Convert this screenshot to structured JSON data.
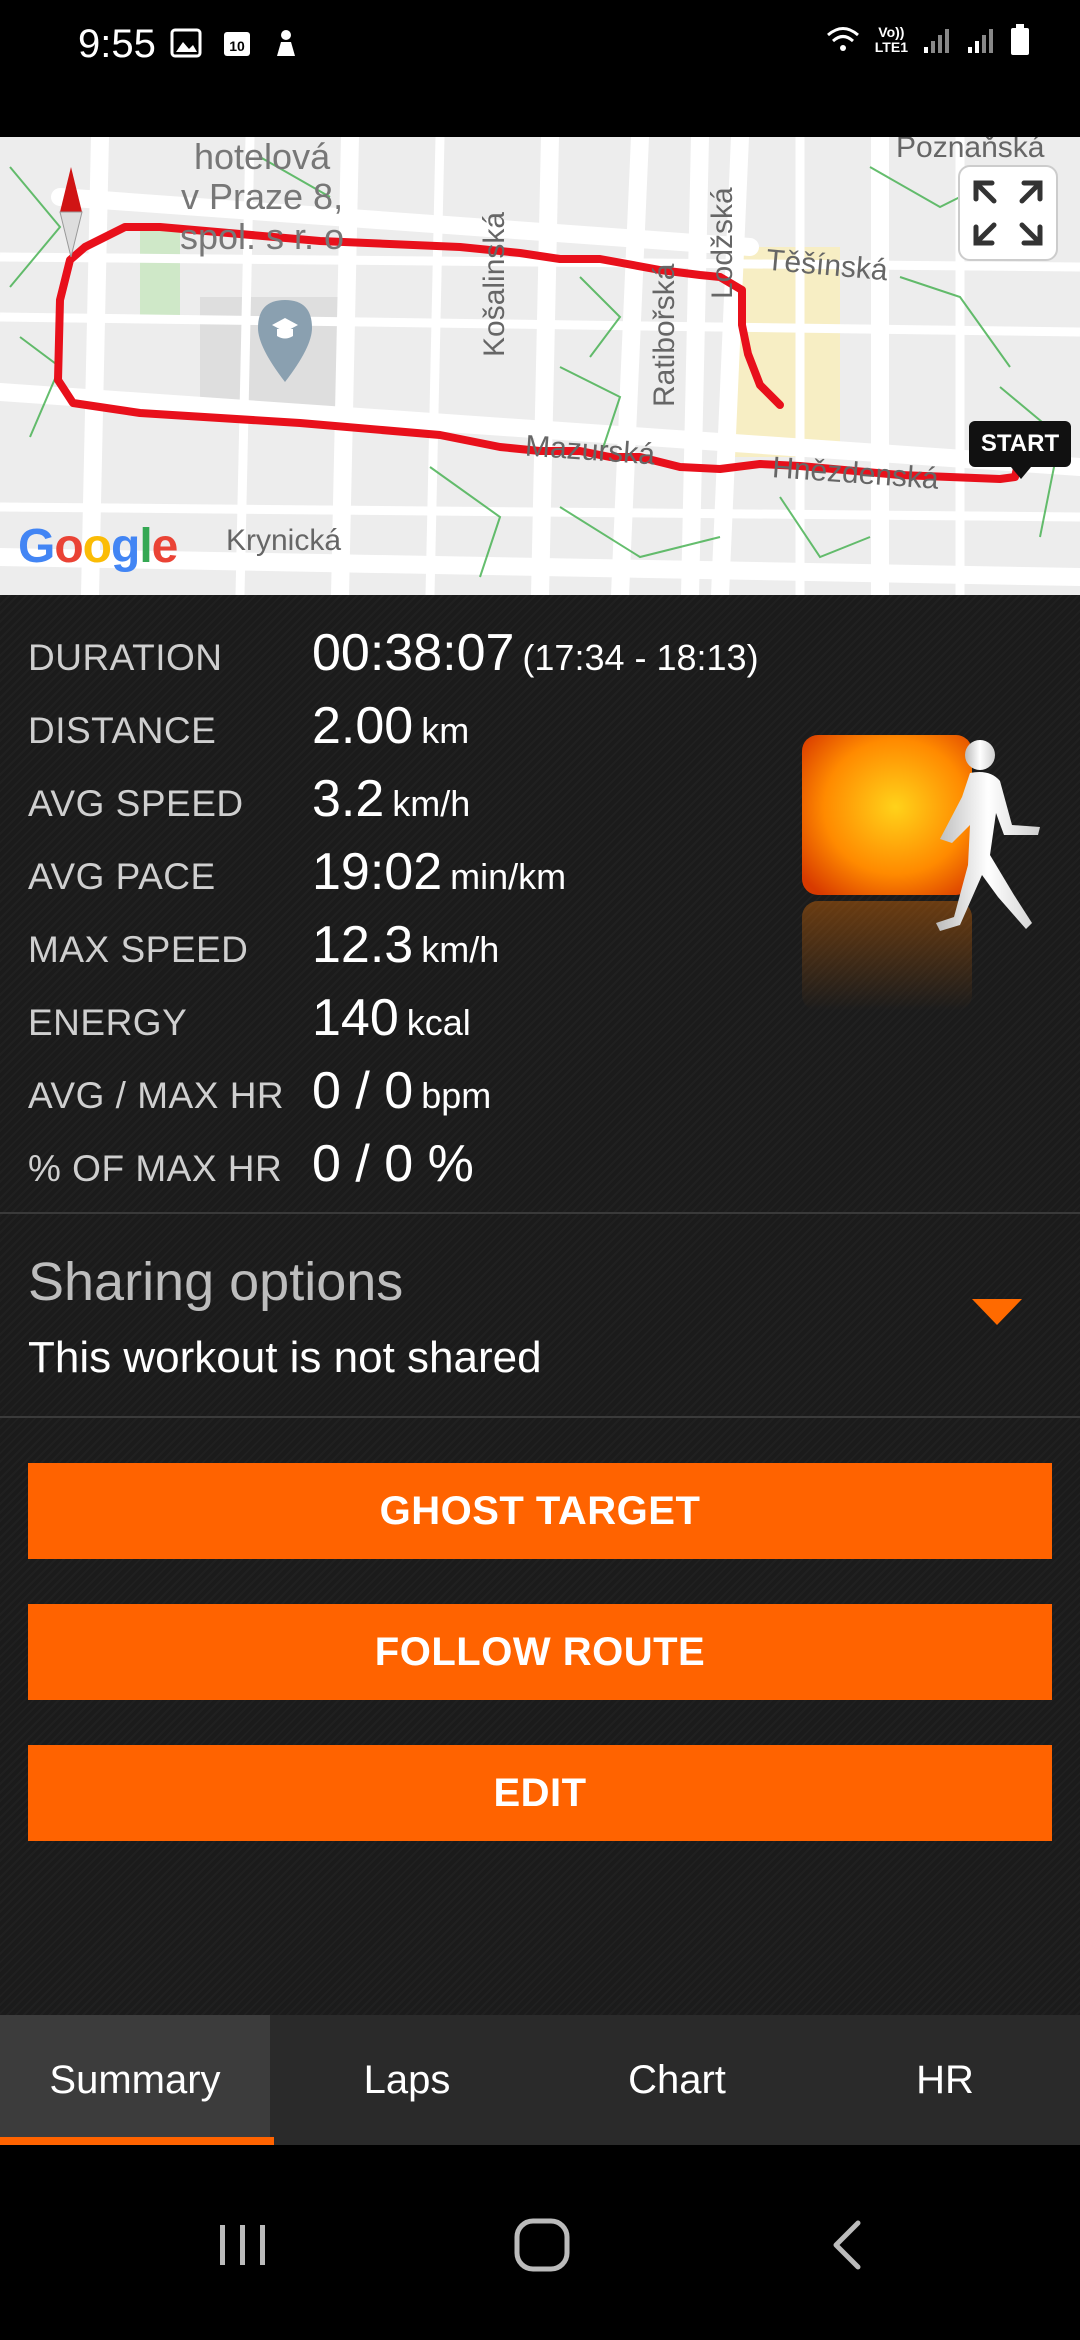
{
  "status_bar": {
    "time": "9:55",
    "left_icons": [
      "image-icon",
      "calendar-icon",
      "person-icon"
    ],
    "calendar_day": "10",
    "right_icons": [
      "wifi-icon",
      "lte-icon",
      "signal-icon",
      "signal-icon",
      "battery-icon"
    ],
    "lte_text_top": "Vo))",
    "lte_text_bottom": "LTE1"
  },
  "map": {
    "labels": {
      "poi_line1": "hotelová",
      "poi_line2": "v Praze 8,",
      "poi_line3": "spol. s r. o",
      "poznanska": "Poznaňská",
      "tesinska": "Těšínská",
      "kosalinska": "Košalinská",
      "ratiborska": "Ratibořská",
      "lodzska": "Lodžská",
      "mazurska": "Mazurská",
      "hnezdenska": "Hnězdenská",
      "krynicka": "Krynická"
    },
    "start_label": "START",
    "google": {
      "G": "G",
      "o1": "o",
      "o2": "o",
      "g": "g",
      "l": "l",
      "e": "e"
    },
    "route_color": "#e8101b"
  },
  "stats": [
    {
      "label": "DURATION",
      "value": "00:38:07",
      "unit": "(17:34 - 18:13)"
    },
    {
      "label": "DISTANCE",
      "value": "2.00",
      "unit": "km"
    },
    {
      "label": "AVG SPEED",
      "value": "3.2",
      "unit": "km/h"
    },
    {
      "label": "AVG PACE",
      "value": "19:02",
      "unit": "min/km"
    },
    {
      "label": "MAX SPEED",
      "value": "12.3",
      "unit": "km/h"
    },
    {
      "label": "ENERGY",
      "value": "140",
      "unit": "kcal"
    },
    {
      "label": "AVG / MAX HR",
      "value": "0 / 0",
      "unit": "bpm"
    },
    {
      "label": "% OF MAX HR",
      "value": "0 / 0 %",
      "unit": ""
    }
  ],
  "sharing": {
    "title": "Sharing options",
    "subtitle": "This workout is not shared"
  },
  "buttons": {
    "ghost_target": "GHOST TARGET",
    "follow_route": "FOLLOW ROUTE",
    "edit": "EDIT"
  },
  "tabs": [
    "Summary",
    "Laps",
    "Chart",
    "HR"
  ],
  "active_tab": "Summary",
  "colors": {
    "accent": "#ff6300",
    "route": "#e8101b",
    "panel": "#1b1b1b"
  }
}
